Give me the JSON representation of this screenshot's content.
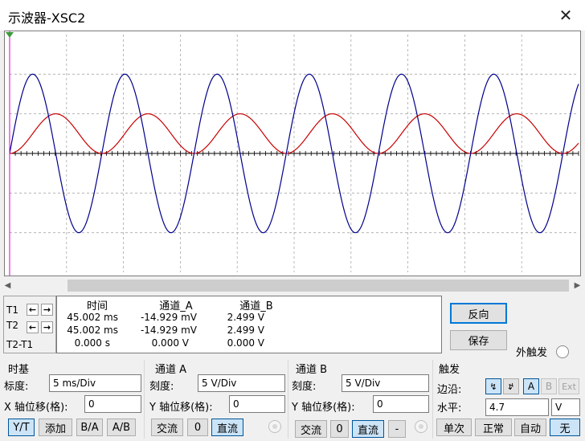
{
  "window": {
    "title": "示波器-XSC2"
  },
  "scope": {
    "colors": {
      "channel_a": "#c80000",
      "channel_b": "#00008b",
      "cursor": "#d800d8",
      "grid": "#a8a8a8",
      "axis": "#000000"
    },
    "grid": {
      "divisions_x": 10,
      "divisions_y": 6
    }
  },
  "chart_data": {
    "type": "line",
    "grid": true,
    "series": [
      {
        "name": "通道_A",
        "color": "#c80000",
        "shape": "sine",
        "amplitude_div": 1,
        "periods_on_screen": 6.17
      },
      {
        "name": "通道_B",
        "color": "#00008b",
        "shape": "sine",
        "amplitude_div": 2,
        "periods_on_screen": 6.17
      }
    ]
  },
  "cursors": {
    "t1_label": "T1",
    "t2_label": "T2",
    "t2t1_label": "T2-T1"
  },
  "readout": {
    "headers": [
      "时间",
      "通道_A",
      "通道_B"
    ],
    "rows": [
      [
        "45.002 ms",
        "-14.929 mV",
        "2.499 V"
      ],
      [
        "45.002 ms",
        "-14.929 mV",
        "2.499 V"
      ],
      [
        "0.000 s",
        "0.000 V",
        "0.000 V"
      ]
    ]
  },
  "actions": {
    "reverse": "反向",
    "save": "保存",
    "ext_trigger": "外触发"
  },
  "timebase": {
    "title": "时基",
    "scale_label": "标度:",
    "scale_value": "5 ms/Div",
    "xpos_label": "X 轴位移(格):",
    "xpos_value": "0",
    "modes": [
      "Y/T",
      "添加",
      "B/A",
      "A/B"
    ]
  },
  "channel_a": {
    "title": "通道 A",
    "scale_label": "刻度:",
    "scale_value": "5  V/Div",
    "ypos_label": "Y 轴位移(格):",
    "ypos_value": "0",
    "coupling": [
      "交流",
      "0",
      "直流"
    ]
  },
  "channel_b": {
    "title": "通道 B",
    "scale_label": "刻度:",
    "scale_value": "5  V/Div",
    "ypos_label": "Y 轴位移(格):",
    "ypos_value": "0",
    "coupling": [
      "交流",
      "0",
      "直流",
      "-"
    ]
  },
  "trigger": {
    "title": "触发",
    "edge_label": "边沿:",
    "edge_rise": "↯",
    "edge_fall": "↯",
    "sources": [
      "A",
      "B",
      "Ext"
    ],
    "level_label": "水平:",
    "level_value": "4.7",
    "level_unit": "V",
    "modes": [
      "单次",
      "正常",
      "自动",
      "无"
    ]
  }
}
